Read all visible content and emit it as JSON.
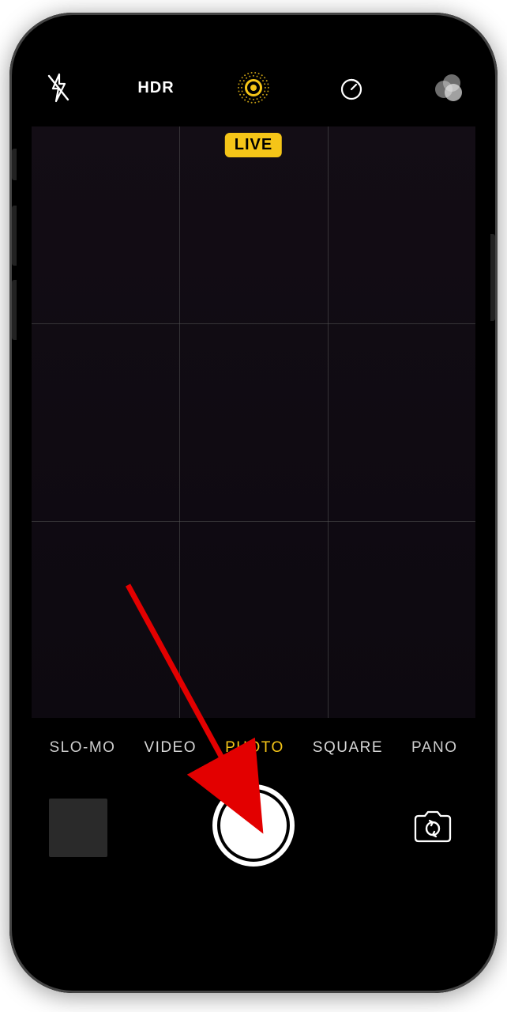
{
  "top": {
    "hdr_label": "HDR"
  },
  "live_badge": "LIVE",
  "modes": {
    "items": [
      "SLO-MO",
      "VIDEO",
      "PHOTO",
      "SQUARE",
      "PANO"
    ],
    "active_index": 2
  },
  "colors": {
    "accent": "#f5c518"
  }
}
